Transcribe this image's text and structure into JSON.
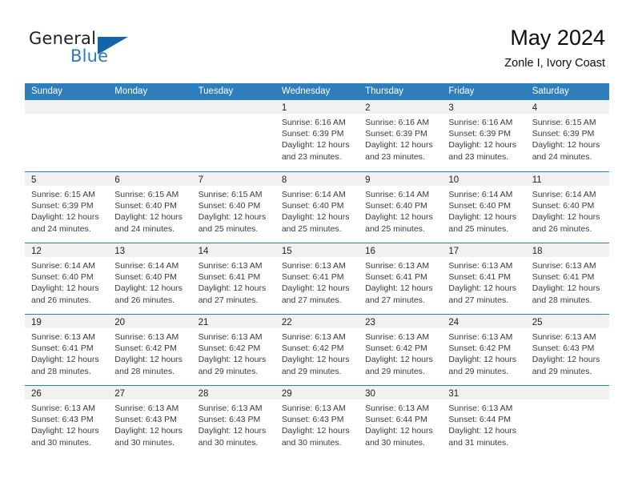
{
  "brand": {
    "word1": "General",
    "word2": "Blue",
    "triangle_color": "#1464aa",
    "blue_text_color": "#2a7ac0"
  },
  "header": {
    "title": "May 2024",
    "subtitle": "Zonle I, Ivory Coast"
  },
  "theme": {
    "header_blue": "#2e7ebc",
    "day_band_gray": "#f1f1f1",
    "text_color": "#3a3a3a"
  },
  "weekdays": [
    "Sunday",
    "Monday",
    "Tuesday",
    "Wednesday",
    "Thursday",
    "Friday",
    "Saturday"
  ],
  "weeks": [
    [
      {
        "day": "",
        "lines": []
      },
      {
        "day": "",
        "lines": []
      },
      {
        "day": "",
        "lines": []
      },
      {
        "day": "1",
        "lines": [
          "Sunrise: 6:16 AM",
          "Sunset: 6:39 PM",
          "Daylight: 12 hours",
          "and 23 minutes."
        ]
      },
      {
        "day": "2",
        "lines": [
          "Sunrise: 6:16 AM",
          "Sunset: 6:39 PM",
          "Daylight: 12 hours",
          "and 23 minutes."
        ]
      },
      {
        "day": "3",
        "lines": [
          "Sunrise: 6:16 AM",
          "Sunset: 6:39 PM",
          "Daylight: 12 hours",
          "and 23 minutes."
        ]
      },
      {
        "day": "4",
        "lines": [
          "Sunrise: 6:15 AM",
          "Sunset: 6:39 PM",
          "Daylight: 12 hours",
          "and 24 minutes."
        ]
      }
    ],
    [
      {
        "day": "5",
        "lines": [
          "Sunrise: 6:15 AM",
          "Sunset: 6:39 PM",
          "Daylight: 12 hours",
          "and 24 minutes."
        ]
      },
      {
        "day": "6",
        "lines": [
          "Sunrise: 6:15 AM",
          "Sunset: 6:40 PM",
          "Daylight: 12 hours",
          "and 24 minutes."
        ]
      },
      {
        "day": "7",
        "lines": [
          "Sunrise: 6:15 AM",
          "Sunset: 6:40 PM",
          "Daylight: 12 hours",
          "and 25 minutes."
        ]
      },
      {
        "day": "8",
        "lines": [
          "Sunrise: 6:14 AM",
          "Sunset: 6:40 PM",
          "Daylight: 12 hours",
          "and 25 minutes."
        ]
      },
      {
        "day": "9",
        "lines": [
          "Sunrise: 6:14 AM",
          "Sunset: 6:40 PM",
          "Daylight: 12 hours",
          "and 25 minutes."
        ]
      },
      {
        "day": "10",
        "lines": [
          "Sunrise: 6:14 AM",
          "Sunset: 6:40 PM",
          "Daylight: 12 hours",
          "and 25 minutes."
        ]
      },
      {
        "day": "11",
        "lines": [
          "Sunrise: 6:14 AM",
          "Sunset: 6:40 PM",
          "Daylight: 12 hours",
          "and 26 minutes."
        ]
      }
    ],
    [
      {
        "day": "12",
        "lines": [
          "Sunrise: 6:14 AM",
          "Sunset: 6:40 PM",
          "Daylight: 12 hours",
          "and 26 minutes."
        ]
      },
      {
        "day": "13",
        "lines": [
          "Sunrise: 6:14 AM",
          "Sunset: 6:40 PM",
          "Daylight: 12 hours",
          "and 26 minutes."
        ]
      },
      {
        "day": "14",
        "lines": [
          "Sunrise: 6:13 AM",
          "Sunset: 6:41 PM",
          "Daylight: 12 hours",
          "and 27 minutes."
        ]
      },
      {
        "day": "15",
        "lines": [
          "Sunrise: 6:13 AM",
          "Sunset: 6:41 PM",
          "Daylight: 12 hours",
          "and 27 minutes."
        ]
      },
      {
        "day": "16",
        "lines": [
          "Sunrise: 6:13 AM",
          "Sunset: 6:41 PM",
          "Daylight: 12 hours",
          "and 27 minutes."
        ]
      },
      {
        "day": "17",
        "lines": [
          "Sunrise: 6:13 AM",
          "Sunset: 6:41 PM",
          "Daylight: 12 hours",
          "and 27 minutes."
        ]
      },
      {
        "day": "18",
        "lines": [
          "Sunrise: 6:13 AM",
          "Sunset: 6:41 PM",
          "Daylight: 12 hours",
          "and 28 minutes."
        ]
      }
    ],
    [
      {
        "day": "19",
        "lines": [
          "Sunrise: 6:13 AM",
          "Sunset: 6:41 PM",
          "Daylight: 12 hours",
          "and 28 minutes."
        ]
      },
      {
        "day": "20",
        "lines": [
          "Sunrise: 6:13 AM",
          "Sunset: 6:42 PM",
          "Daylight: 12 hours",
          "and 28 minutes."
        ]
      },
      {
        "day": "21",
        "lines": [
          "Sunrise: 6:13 AM",
          "Sunset: 6:42 PM",
          "Daylight: 12 hours",
          "and 29 minutes."
        ]
      },
      {
        "day": "22",
        "lines": [
          "Sunrise: 6:13 AM",
          "Sunset: 6:42 PM",
          "Daylight: 12 hours",
          "and 29 minutes."
        ]
      },
      {
        "day": "23",
        "lines": [
          "Sunrise: 6:13 AM",
          "Sunset: 6:42 PM",
          "Daylight: 12 hours",
          "and 29 minutes."
        ]
      },
      {
        "day": "24",
        "lines": [
          "Sunrise: 6:13 AM",
          "Sunset: 6:42 PM",
          "Daylight: 12 hours",
          "and 29 minutes."
        ]
      },
      {
        "day": "25",
        "lines": [
          "Sunrise: 6:13 AM",
          "Sunset: 6:43 PM",
          "Daylight: 12 hours",
          "and 29 minutes."
        ]
      }
    ],
    [
      {
        "day": "26",
        "lines": [
          "Sunrise: 6:13 AM",
          "Sunset: 6:43 PM",
          "Daylight: 12 hours",
          "and 30 minutes."
        ]
      },
      {
        "day": "27",
        "lines": [
          "Sunrise: 6:13 AM",
          "Sunset: 6:43 PM",
          "Daylight: 12 hours",
          "and 30 minutes."
        ]
      },
      {
        "day": "28",
        "lines": [
          "Sunrise: 6:13 AM",
          "Sunset: 6:43 PM",
          "Daylight: 12 hours",
          "and 30 minutes."
        ]
      },
      {
        "day": "29",
        "lines": [
          "Sunrise: 6:13 AM",
          "Sunset: 6:43 PM",
          "Daylight: 12 hours",
          "and 30 minutes."
        ]
      },
      {
        "day": "30",
        "lines": [
          "Sunrise: 6:13 AM",
          "Sunset: 6:44 PM",
          "Daylight: 12 hours",
          "and 30 minutes."
        ]
      },
      {
        "day": "31",
        "lines": [
          "Sunrise: 6:13 AM",
          "Sunset: 6:44 PM",
          "Daylight: 12 hours",
          "and 31 minutes."
        ]
      },
      {
        "day": "",
        "lines": []
      }
    ]
  ]
}
